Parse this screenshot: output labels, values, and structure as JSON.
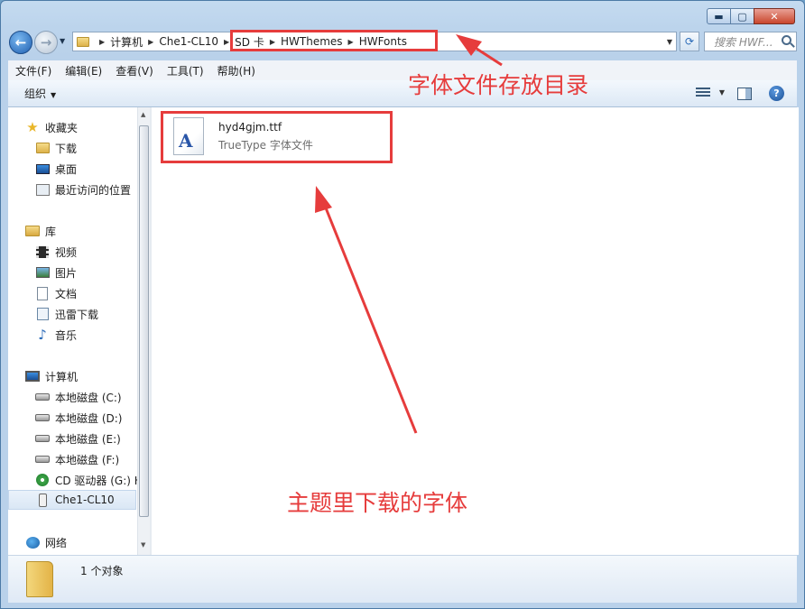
{
  "window": {
    "caption_buttons": {
      "minimize": "▬",
      "maximize": "▢",
      "close": "✕"
    }
  },
  "navbar": {
    "breadcrumbs": [
      "计算机",
      "Che1-CL10",
      "SD 卡",
      "HWThemes",
      "HWFonts"
    ],
    "search_placeholder": "搜索 HWF..."
  },
  "menubar": {
    "items": [
      "文件(F)",
      "编辑(E)",
      "查看(V)",
      "工具(T)",
      "帮助(H)"
    ]
  },
  "toolbar": {
    "organize_label": "组织"
  },
  "nav_pane": {
    "favorites_header": "收藏夹",
    "favorites": [
      "下载",
      "桌面",
      "最近访问的位置"
    ],
    "library_header": "库",
    "libraries": [
      "视频",
      "图片",
      "文档",
      "迅雷下载",
      "音乐"
    ],
    "computer_header": "计算机",
    "drives": [
      "本地磁盘 (C:)",
      "本地磁盘 (D:)",
      "本地磁盘 (E:)",
      "本地磁盘 (F:)",
      "CD 驱动器 (G:) H",
      "Che1-CL10"
    ],
    "network_header": "网络"
  },
  "content": {
    "file": {
      "name": "hyd4gjm.ttf",
      "type": "TrueType 字体文件",
      "icon_letter": "A"
    }
  },
  "details": {
    "item_count": "1 个对象"
  },
  "annotations": {
    "path_note": "字体文件存放目录",
    "file_note": "主题里下载的字体",
    "color": "#e63c3c"
  }
}
